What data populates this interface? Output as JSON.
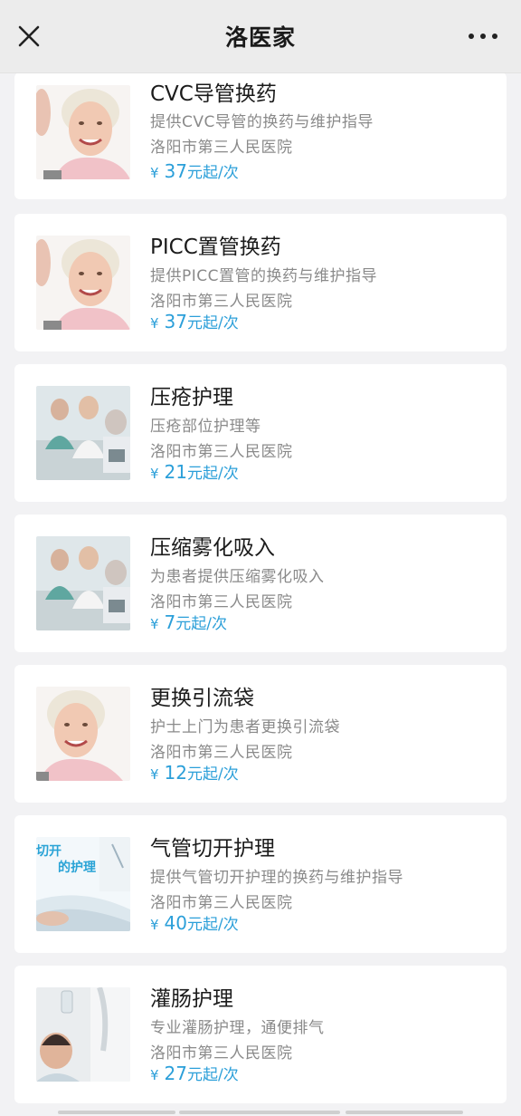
{
  "header": {
    "title": "洛医家"
  },
  "services": [
    {
      "title": "CVC导管换药",
      "desc": "提供CVC导管的换药与维护指导",
      "hospital": "洛阳市第三人民医院",
      "currency": "¥",
      "price": "37",
      "unit": "元起/次",
      "thumb": "elderly-woman-photo"
    },
    {
      "title": "PICC置管换药",
      "desc": "提供PICC置管的换药与维护指导",
      "hospital": "洛阳市第三人民医院",
      "currency": "¥",
      "price": "37",
      "unit": "元起/次",
      "thumb": "elderly-woman-photo"
    },
    {
      "title": "压疮护理",
      "desc": "压疮部位护理等",
      "hospital": "洛阳市第三人民医院",
      "currency": "¥",
      "price": "21",
      "unit": "元起/次",
      "thumb": "medical-staff-photo"
    },
    {
      "title": "压缩雾化吸入",
      "desc": "为患者提供压缩雾化吸入",
      "hospital": "洛阳市第三人民医院",
      "currency": "¥",
      "price": "7",
      "unit": "元起/次",
      "thumb": "medical-staff-photo"
    },
    {
      "title": "更换引流袋",
      "desc": "护士上门为患者更换引流袋",
      "hospital": "洛阳市第三人民医院",
      "currency": "¥",
      "price": "12",
      "unit": "元起/次",
      "thumb": "elderly-woman-photo"
    },
    {
      "title": "气管切开护理",
      "desc": "提供气管切开护理的换药与维护指导",
      "hospital": "洛阳市第三人民医院",
      "currency": "¥",
      "price": "40",
      "unit": "元起/次",
      "thumb": "tracheotomy-care-banner",
      "thumb_text": [
        "切开",
        "的护理"
      ]
    },
    {
      "title": "灌肠护理",
      "desc": "专业灌肠护理，通便排气",
      "hospital": "洛阳市第三人民医院",
      "currency": "¥",
      "price": "27",
      "unit": "元起/次",
      "thumb": "patient-iv-photo"
    }
  ],
  "colors": {
    "accent": "#2b9fd9",
    "background": "#f2f2f4",
    "card": "#ffffff",
    "header": "#ececec"
  }
}
